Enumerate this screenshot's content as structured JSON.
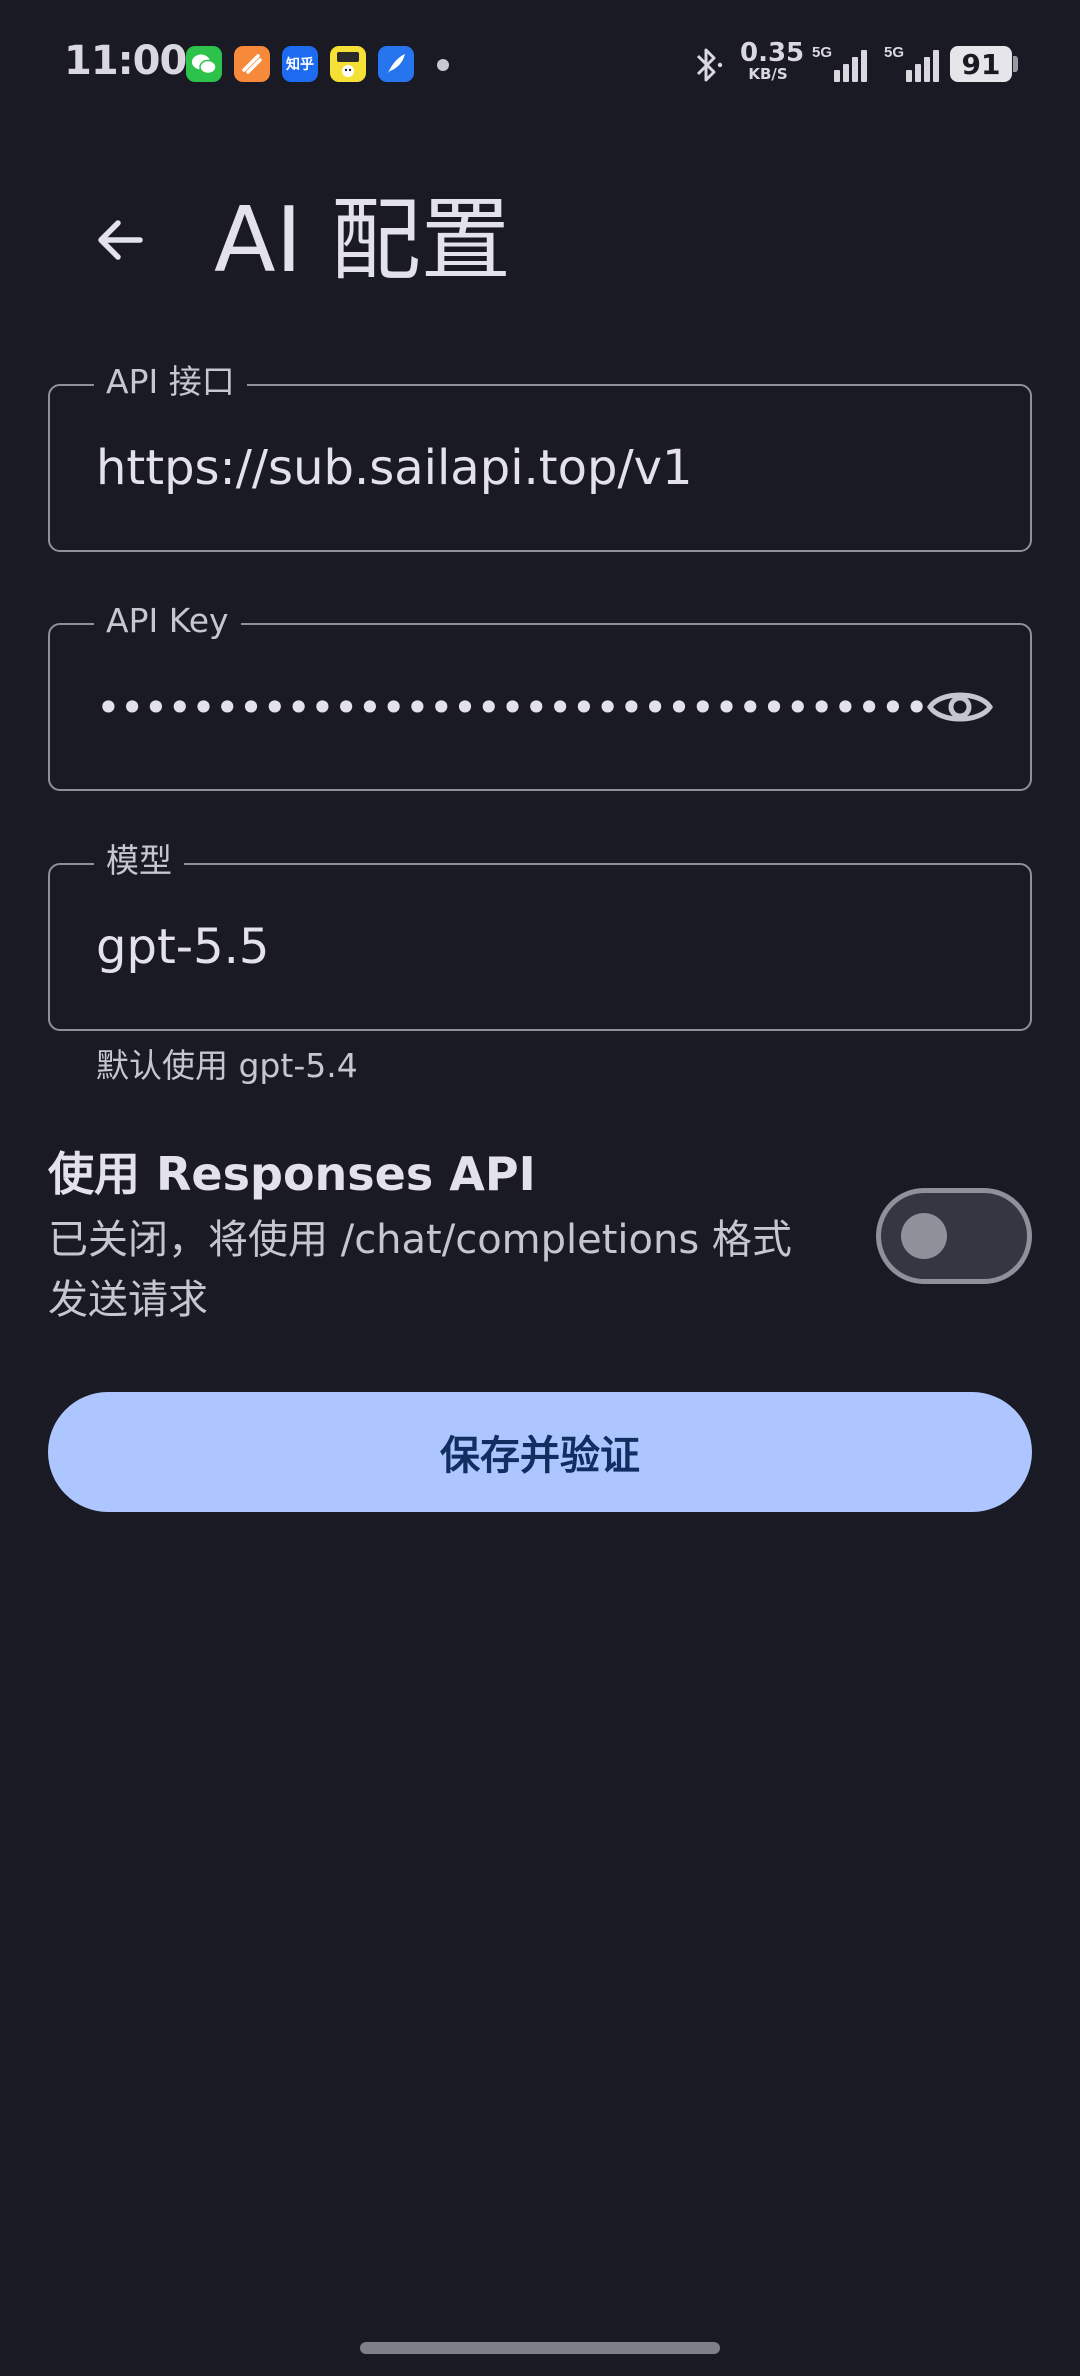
{
  "status_bar": {
    "time": "11:00",
    "zhihu_label": "知乎",
    "net_speed_value": "0.35",
    "net_speed_unit": "KB/S",
    "signal_1_label": "5G",
    "signal_2_label": "5G",
    "battery_level": "91",
    "icons": [
      "wechat-icon",
      "orange-app-icon",
      "zhihu-icon",
      "yellow-app-icon",
      "feather-app-icon",
      "notification-dot",
      "bluetooth-icon",
      "signal-icon",
      "battery-icon"
    ]
  },
  "header": {
    "title": "AI 配置",
    "back_icon": "arrow-left-icon"
  },
  "fields": {
    "api_endpoint": {
      "label": "API 接口",
      "value": "https://sub.sailapi.top/v1"
    },
    "api_key": {
      "label": "API Key",
      "value_masked": "••••••••••••••••••••••••••••••••••••••••••••••••••••",
      "toggle_icon": "eye-icon"
    },
    "model": {
      "label": "模型",
      "value": "gpt-5.5",
      "supporting_text": "默认使用 gpt-5.4"
    }
  },
  "responses_api": {
    "title": "使用 Responses API",
    "description": "已关闭，将使用 /chat/completions 格式发送请求",
    "enabled": false
  },
  "actions": {
    "save_label": "保存并验证"
  },
  "colors": {
    "background": "#191a24",
    "primary": "#adc6ff",
    "on_primary": "#102f60",
    "outline": "#8f909a",
    "text": "#e3e2ea",
    "text_secondary": "#c5c6d0"
  }
}
